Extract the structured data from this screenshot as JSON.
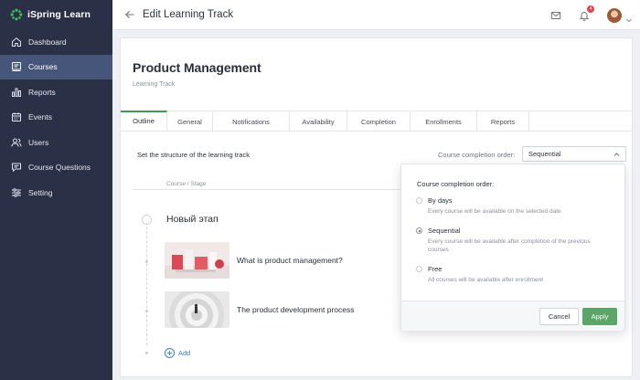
{
  "brand": {
    "name": "iSpring Learn",
    "color": "#3fbf5a"
  },
  "sidebar": {
    "items": [
      {
        "label": "Dashboard",
        "icon": "home-icon"
      },
      {
        "label": "Courses",
        "icon": "courses-icon",
        "active": true
      },
      {
        "label": "Reports",
        "icon": "bar-chart-icon"
      },
      {
        "label": "Events",
        "icon": "calendar-icon"
      },
      {
        "label": "Users",
        "icon": "users-icon"
      },
      {
        "label": "Course Questions",
        "icon": "chat-icon"
      },
      {
        "label": "Setting",
        "icon": "sliders-icon"
      }
    ]
  },
  "topbar": {
    "title": "Edit Learning Track",
    "notifications_count": "4"
  },
  "page": {
    "title": "Product Management",
    "subtitle": "Learning Track"
  },
  "tabs": [
    {
      "label": "Outline",
      "active": true
    },
    {
      "label": "General"
    },
    {
      "label": "Notifications"
    },
    {
      "label": "Availability"
    },
    {
      "label": "Completion"
    },
    {
      "label": "Enrollments"
    },
    {
      "label": "Reports"
    }
  ],
  "structure": {
    "label": "Set the structure of the learning track",
    "order_label": "Course completion order:",
    "order_value": "Sequential",
    "column_header": "Course / Stage"
  },
  "stage": {
    "title": "Новый этап"
  },
  "courses": [
    {
      "title": "What is product management?"
    },
    {
      "title": "The product development process"
    }
  ],
  "add_label": "Add",
  "dropdown": {
    "title": "Course completion order:",
    "options": [
      {
        "label": "By days",
        "desc": "Every course will be available on the selected date",
        "checked": false
      },
      {
        "label": "Sequential",
        "desc": "Every course will be available after completion of the previous courses",
        "checked": true
      },
      {
        "label": "Free",
        "desc": "All courses will be available after enrollment",
        "checked": false
      }
    ],
    "cancel": "Cancel",
    "apply": "Apply"
  },
  "colors": {
    "sidebar_bg": "#2a3045",
    "sidebar_active": "#46557a",
    "accent_green": "#5aa567",
    "link_blue": "#3b82c4",
    "badge_red": "#e8414c"
  }
}
